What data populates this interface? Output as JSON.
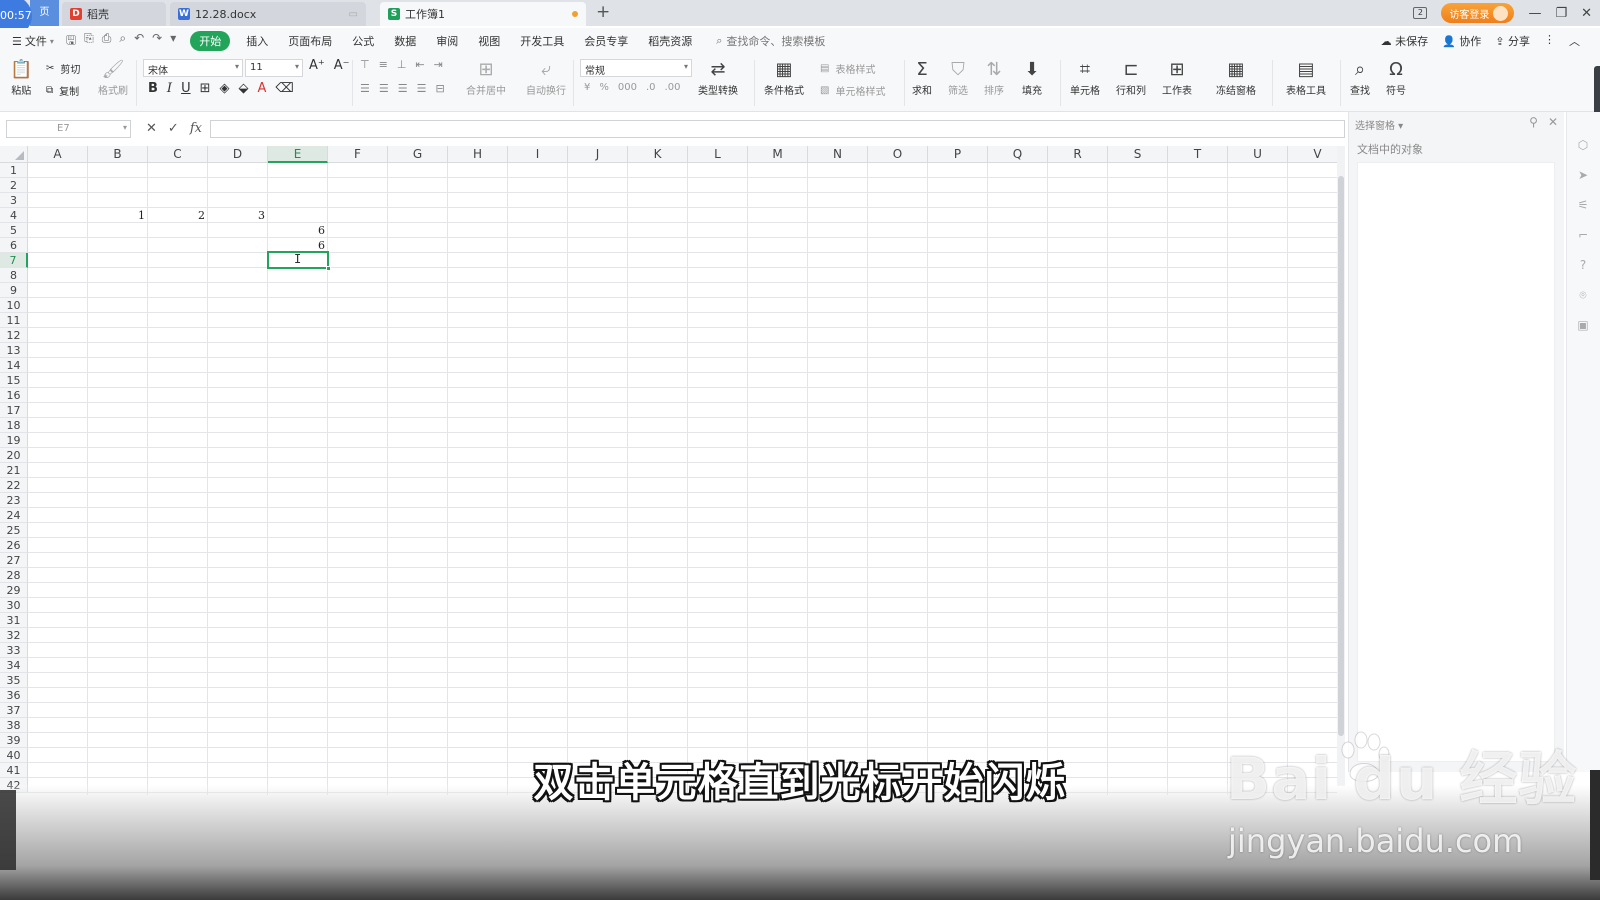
{
  "clock": "00:57",
  "home_tab_label": "页",
  "tabs": [
    {
      "label": "稻壳",
      "icon": "wps-docer-icon"
    },
    {
      "label": "12.28.docx",
      "icon": "word-doc-icon"
    },
    {
      "label": "工作簿1",
      "icon": "sheet-icon"
    }
  ],
  "title_right": {
    "login": "访客登录"
  },
  "menu": {
    "file": "文件",
    "items": [
      "开始",
      "插入",
      "页面布局",
      "公式",
      "数据",
      "审阅",
      "视图",
      "开发工具",
      "会员专享",
      "稻壳资源"
    ],
    "search_placeholder": "查找命令、搜索模板",
    "right": [
      "未保存",
      "协作",
      "分享"
    ]
  },
  "ribbon": {
    "paste": "粘贴",
    "cut": "剪切",
    "copy": "复制",
    "format_painter": "格式刷",
    "font_name": "宋体",
    "font_size": "11",
    "merge_center": "合并居中",
    "wrap_text": "自动换行",
    "number_format": "常规",
    "type_convert": "类型转换",
    "cond_format": "条件格式",
    "table_style": "表格样式",
    "cell_style": "单元格样式",
    "sum": "求和",
    "filter": "筛选",
    "sort": "排序",
    "fill": "填充",
    "cell": "单元格",
    "row_col": "行和列",
    "worksheet": "工作表",
    "freeze": "冻结窗格",
    "table_tools": "表格工具",
    "find": "查找",
    "symbol": "符号"
  },
  "formula_bar": {
    "name_box": "E7",
    "fx": "fx",
    "value": ""
  },
  "columns": [
    "A",
    "B",
    "C",
    "D",
    "E",
    "F",
    "G",
    "H",
    "I",
    "J",
    "K",
    "L",
    "M",
    "N",
    "O",
    "P",
    "Q",
    "R",
    "S",
    "T",
    "U",
    "V"
  ],
  "selected_column": "E",
  "selected_row": 7,
  "row_count": 42,
  "cells": [
    {
      "ref": "B4",
      "value": "1"
    },
    {
      "ref": "C4",
      "value": "2"
    },
    {
      "ref": "D4",
      "value": "3"
    },
    {
      "ref": "E5",
      "value": "6"
    },
    {
      "ref": "E6",
      "value": "6"
    }
  ],
  "side_pane": {
    "title": "选择窗格",
    "subtitle": "文档中的对象"
  },
  "subtitle": "双击单元格直到光标开始闪烁",
  "watermark": {
    "logo": "Bai  du 经验",
    "url": "jingyan.baidu.com"
  }
}
